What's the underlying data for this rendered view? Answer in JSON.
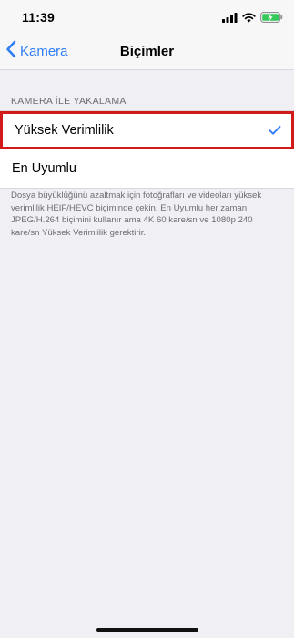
{
  "status_bar": {
    "time": "11:39",
    "icons": [
      "signal-icon",
      "wifi-icon",
      "battery-charging-icon"
    ]
  },
  "nav": {
    "back_label": "Kamera",
    "title": "Biçimler"
  },
  "section": {
    "header": "KAMERA İLE YAKALAMA",
    "options": [
      {
        "label": "Yüksek Verimlilik",
        "selected": true
      },
      {
        "label": "En Uyumlu",
        "selected": false
      }
    ],
    "footer": "Dosya büyüklüğünü azaltmak için fotoğrafları ve videoları yüksek verimlilik HEIF/HEVC biçiminde çekin. En Uyumlu her zaman JPEG/H.264 biçimini kullanır ama 4K 60 kare/sn ve 1080p 240 kare/sn Yüksek Verimlilik gerektirir."
  },
  "colors": {
    "accent": "#2f7ef6",
    "highlight_border": "#d11a1a",
    "background": "#efeff4"
  }
}
